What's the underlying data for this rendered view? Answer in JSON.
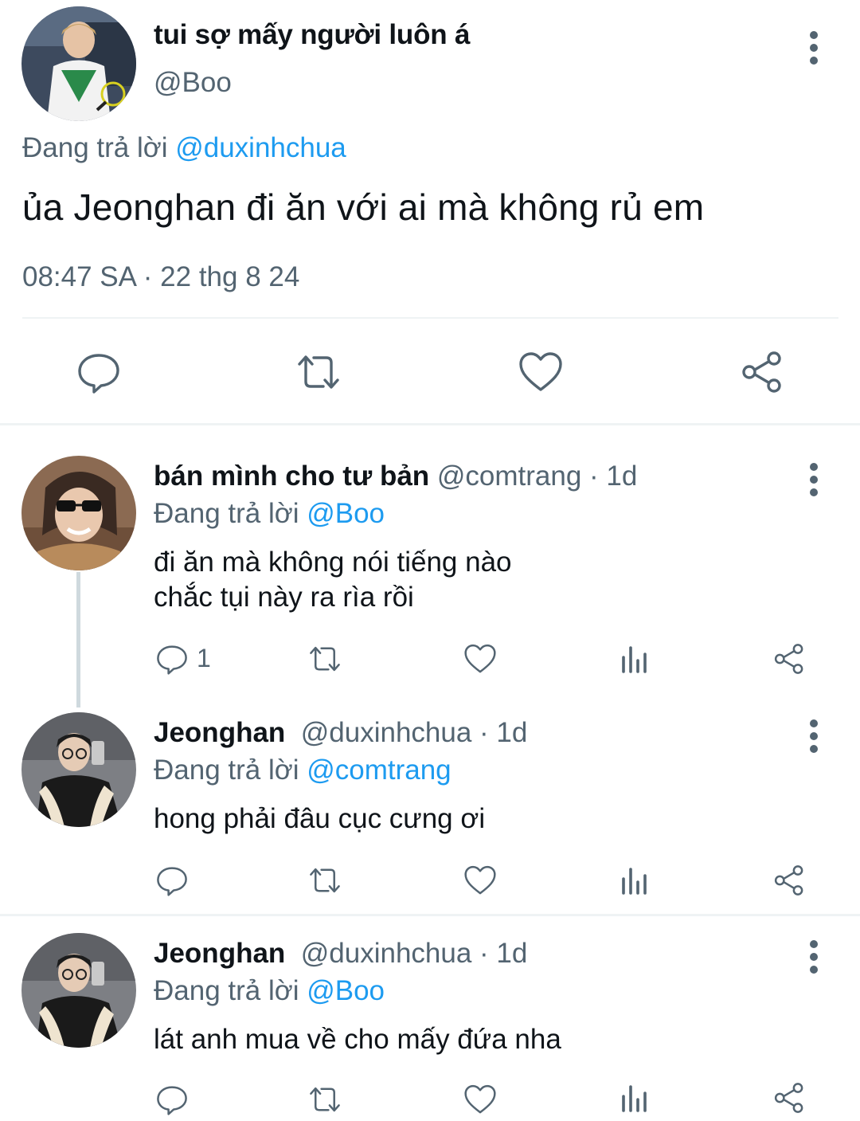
{
  "main_tweet": {
    "display_name": "tui sợ mấy người luôn á",
    "handle": "@Boo",
    "replying_prefix": "Đang trả lời",
    "replying_to": "@duxinhchua",
    "text": "ủa Jeonghan đi ăn với ai mà không rủ em",
    "timestamp": "08:47 SA · 22 thg 8 24",
    "actions": [
      "reply-icon",
      "retweet-icon",
      "like-icon",
      "share-icon"
    ]
  },
  "replies": [
    {
      "display_name": "bán mình cho tư bản",
      "meta": "@comtrang · 1d",
      "replying_prefix": "Đang trả lời",
      "replying_to": "@Boo",
      "text_lines": [
        "đi ăn mà không nói tiếng nào",
        "chắc tụi này ra rìa rồi"
      ],
      "reply_count": "1"
    },
    {
      "display_name": "Jeonghan",
      "meta": "@duxinhchua · 1d",
      "replying_prefix": "Đang trả lời",
      "replying_to": "@comtrang",
      "text_lines": [
        "hong phải đâu cục cưng ơi"
      ],
      "reply_count": ""
    },
    {
      "display_name": "Jeonghan",
      "meta": "@duxinhchua · 1d",
      "replying_prefix": "Đang trả lời",
      "replying_to": "@Boo",
      "text_lines": [
        "lát anh mua về cho mấy đứa nha"
      ],
      "reply_count": ""
    }
  ],
  "colors": {
    "text": "#0f1419",
    "secondary": "#536471",
    "link": "#1d9bf0",
    "divider": "#eff3f4"
  }
}
